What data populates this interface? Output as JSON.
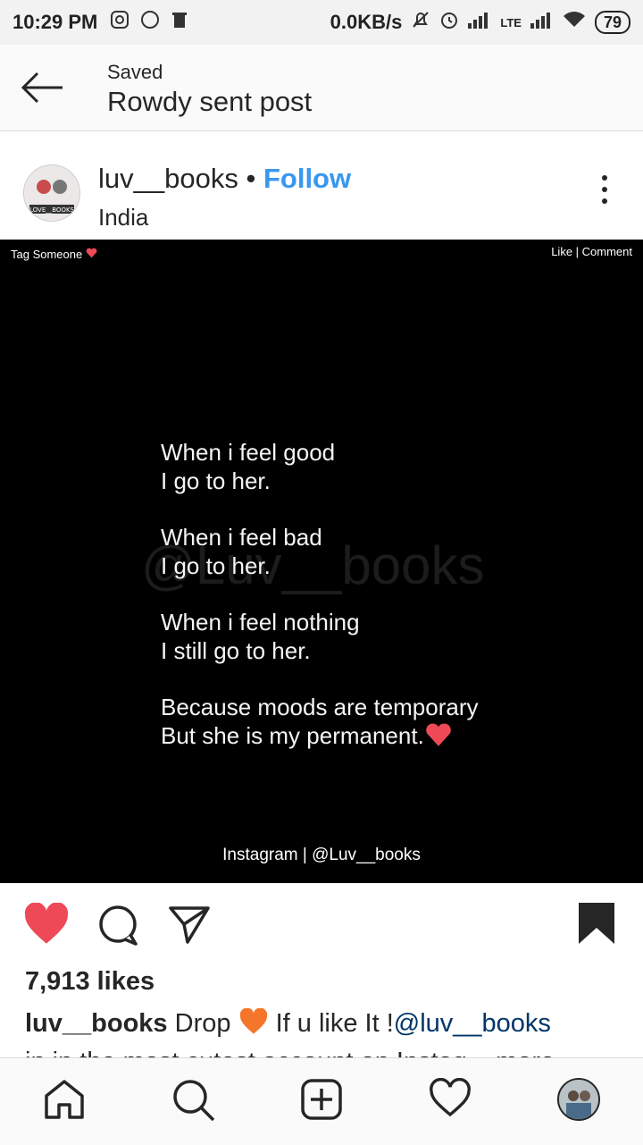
{
  "status_bar": {
    "time": "10:29 PM",
    "network_speed": "0.0KB/s",
    "network_type": "LTE",
    "battery": "79"
  },
  "header": {
    "subtitle": "Saved",
    "title": "Rowdy sent post"
  },
  "post": {
    "username": "luv__books",
    "separator": "•",
    "follow_label": "Follow",
    "location": "India",
    "avatar_text": "LOVE__BOOKS",
    "image": {
      "tag_text": "Tag Someone",
      "like_comment_text": "Like | Comment",
      "watermark": "@Luv__books",
      "quote_stanzas": [
        [
          "When i feel good",
          "I go to her."
        ],
        [
          "When i feel bad",
          "I go to her."
        ],
        [
          "When i feel nothing",
          "I still go to her."
        ],
        [
          "Because moods are temporary",
          "But she is my permanent."
        ]
      ],
      "credit": "Instagram | @Luv__books"
    },
    "likes": "7,913 likes",
    "caption": {
      "username": "luv__books",
      "text_before": " Drop ",
      "text_after": " If u like It !",
      "mention": "@luv__books",
      "line2": "in in the most cutest account on Instag... more"
    }
  },
  "colors": {
    "like_red": "#ed4956",
    "link_blue": "#3897f0",
    "heart_orange": "#f5762a"
  },
  "icons": {
    "actions": [
      "heart-filled-icon",
      "comment-icon",
      "share-icon",
      "bookmark-filled-icon"
    ],
    "nav": [
      "home-icon",
      "search-icon",
      "add-post-icon",
      "activity-heart-icon",
      "profile-avatar"
    ]
  }
}
